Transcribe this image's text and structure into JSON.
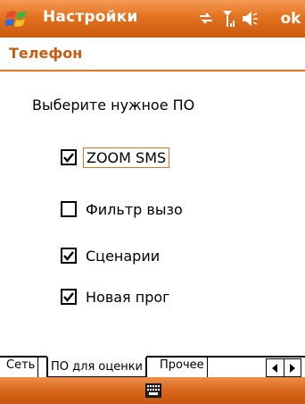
{
  "titlebar": {
    "title": "Настройки",
    "ok_label": "ok"
  },
  "header": {
    "title": "Телефон"
  },
  "main": {
    "prompt": "Выберите нужное ПО",
    "options": [
      {
        "label": "ZOOM SMS",
        "checked": true
      },
      {
        "label": "Фильтр вызо",
        "checked": false
      },
      {
        "label": "Сценарии",
        "checked": true
      },
      {
        "label": "Новая прог",
        "checked": true
      }
    ]
  },
  "tabs": [
    {
      "label": "Сеть"
    },
    {
      "label": "ПО для оценки"
    },
    {
      "label": "Прочее"
    }
  ],
  "colors": {
    "accent": "#e2721f",
    "header_text": "#c75c12"
  },
  "icons": [
    "windows-logo-icon",
    "sync-icon",
    "signal-icon",
    "volume-icon",
    "keyboard-icon"
  ]
}
